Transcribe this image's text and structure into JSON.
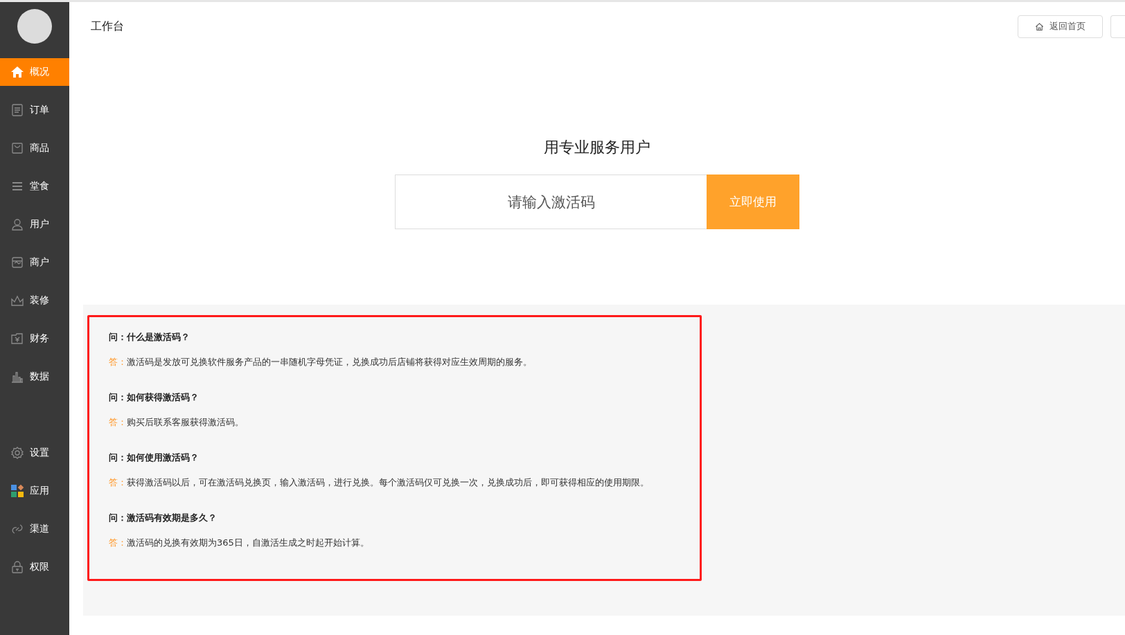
{
  "sidebar": {
    "nav_main": [
      {
        "label": "概况",
        "selected": true
      },
      {
        "label": "订单",
        "selected": false
      },
      {
        "label": "商品",
        "selected": false
      },
      {
        "label": "堂食",
        "selected": false
      },
      {
        "label": "用户",
        "selected": false
      },
      {
        "label": "商户",
        "selected": false
      },
      {
        "label": "装修",
        "selected": false
      },
      {
        "label": "财务",
        "selected": false
      },
      {
        "label": "数据",
        "selected": false
      }
    ],
    "nav_bottom": [
      {
        "label": "设置",
        "selected": false
      },
      {
        "label": "应用",
        "selected": false
      },
      {
        "label": "渠道",
        "selected": false
      },
      {
        "label": "权限",
        "selected": false
      }
    ]
  },
  "header": {
    "title": "工作台",
    "home_button": "返回首页"
  },
  "activation": {
    "heading": "用专业服务用户",
    "placeholder": "请输入激活码",
    "submit": "立即使用"
  },
  "faq": [
    {
      "question": "问：什么是激活码？",
      "answer_prefix": "答：",
      "answer": "激活码是发放可兑换软件服务产品的一串随机字母凭证，兑换成功后店铺将获得对应生效周期的服务。"
    },
    {
      "question": "问：如何获得激活码？",
      "answer_prefix": "答：",
      "answer": "购买后联系客服获得激活码。"
    },
    {
      "question": "问：如何使用激活码？",
      "answer_prefix": "答：",
      "answer": "获得激活码以后，可在激活码兑换页，输入激活码，进行兑换。每个激活码仅可兑换一次，兑换成功后，即可获得相应的使用期限。"
    },
    {
      "question": "问：激活码有效期是多久？",
      "answer_prefix": "答：",
      "answer": "激活码的兑换有效期为365日，自激活生成之时起开始计算。"
    }
  ]
}
